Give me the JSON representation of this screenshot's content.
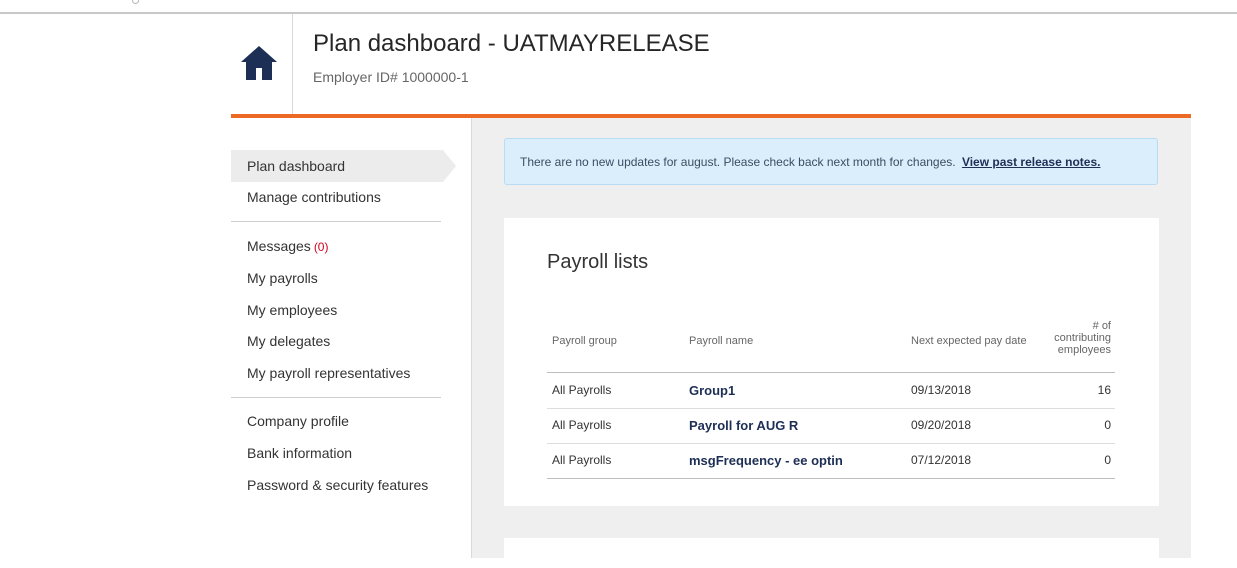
{
  "header": {
    "title": "Plan dashboard - UATMAYRELEASE",
    "employer_id": "Employer ID# 1000000-1",
    "home_icon": "home-icon",
    "accent_color": "#ec6a26",
    "icon_color": "#1d2f55"
  },
  "sidebar": {
    "items": [
      {
        "label": "Plan dashboard",
        "active": true
      },
      {
        "label": "Manage contributions"
      },
      {
        "label": "Messages",
        "count": "(0)"
      },
      {
        "label": "My payrolls"
      },
      {
        "label": "My employees"
      },
      {
        "label": "My delegates"
      },
      {
        "label": "My payroll representatives"
      },
      {
        "label": "Company profile"
      },
      {
        "label": "Bank information"
      },
      {
        "label": "Password & security features"
      }
    ]
  },
  "banner": {
    "text": "There are no new updates for august. Please check back next month for changes.",
    "link": "View past release notes."
  },
  "payroll_lists": {
    "title": "Payroll lists",
    "columns": [
      "Payroll group",
      "Payroll name",
      "Next expected pay date",
      "# of",
      "contributing",
      "employees"
    ],
    "rows": [
      {
        "group": "All Payrolls",
        "name": "Group1",
        "date": "09/13/2018",
        "count": "16"
      },
      {
        "group": "All Payrolls",
        "name": "Payroll for AUG R",
        "date": "09/20/2018",
        "count": "0"
      },
      {
        "group": "All Payrolls",
        "name": "msgFrequency - ee optin",
        "date": "07/12/2018",
        "count": "0"
      }
    ]
  }
}
